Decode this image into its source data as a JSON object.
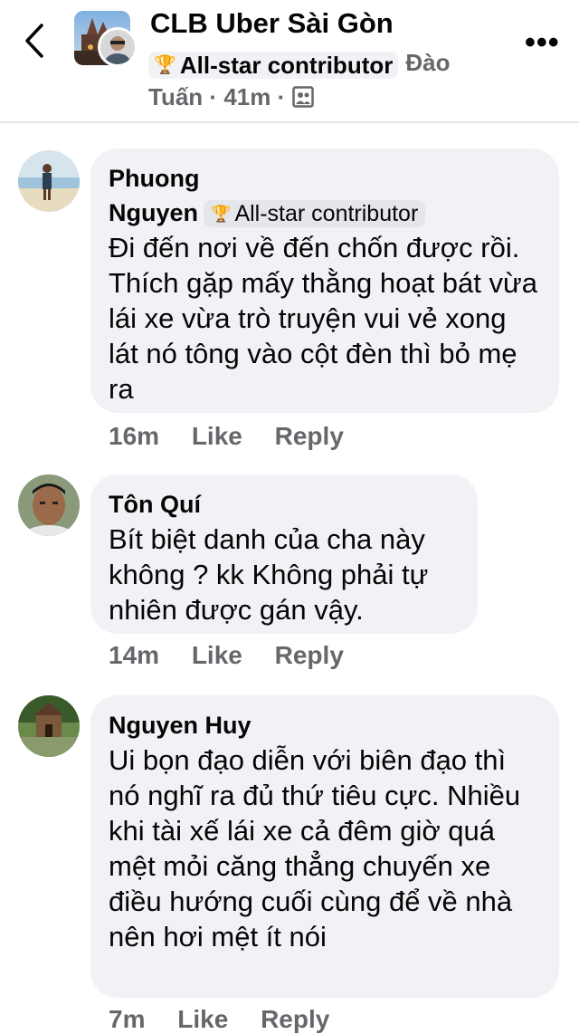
{
  "header": {
    "group_name": "CLB Uber Sài Gòn",
    "badge_label": "All-star contributor",
    "author_first": "Đào",
    "author_last": "Tuấn",
    "time": "41m",
    "separator": "·",
    "more_label": "•••"
  },
  "comments": [
    {
      "name_line1": "Phuong",
      "name_line2": "Nguyen",
      "badge_label": "All-star contributor",
      "text": "Đi đến nơi về đến chốn được rồi. Thích gặp mấy thằng hoạt bát vừa lái xe vừa trò truyện vui vẻ xong lát nó tông vào cột đèn thì bỏ mẹ ra",
      "time": "16m",
      "like": "Like",
      "reply": "Reply"
    },
    {
      "name": "Tôn Quí",
      "text": "Bít biệt danh của cha này không ? kk Không phải tự nhiên được gán vậy.",
      "time": "14m",
      "like": "Like",
      "reply": "Reply"
    },
    {
      "name": "Nguyen Huy",
      "text": "Ui bọn đạo diễn với biên đạo thì nó nghĩ ra đủ thứ tiêu cực. Nhiều khi tài xế lái xe cả đêm giờ quá mệt mỏi căng thẳng chuyến xe điều hướng cuối cùng để về nhà nên hơi mệt ít nói",
      "time": "7m",
      "like": "Like",
      "reply": "Reply"
    }
  ],
  "icons": {
    "back": "chevron-left-icon",
    "trophy": "trophy-icon",
    "privacy": "group-members-icon",
    "more": "more-horizontal-icon"
  },
  "colors": {
    "bubble_bg": "#f0f2f5",
    "meta_gray": "#65676b",
    "text": "#050505"
  }
}
